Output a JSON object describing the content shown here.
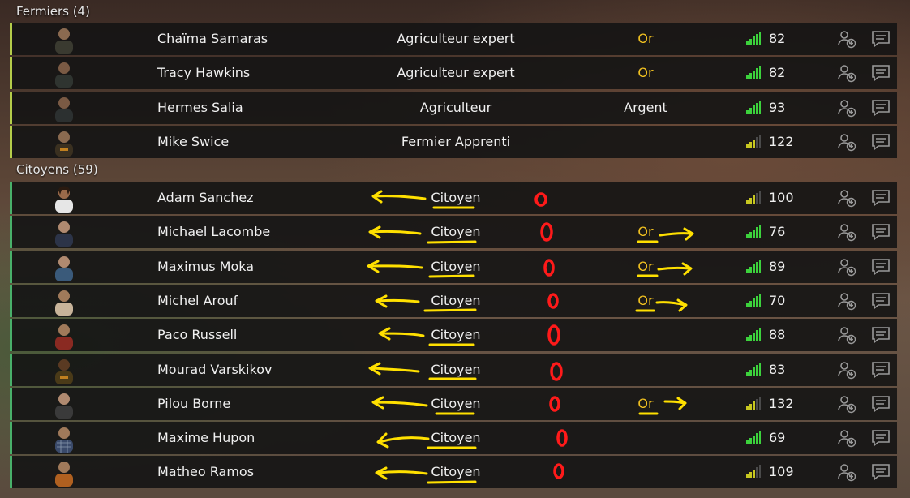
{
  "groups": [
    {
      "title": "Fermiers (4)",
      "players": [
        {
          "name": "Chaïma Samaras",
          "role": "Agriculteur expert",
          "rank": "Or",
          "ping": "82",
          "signal": "full",
          "avatar": "#3a3a30"
        },
        {
          "name": "Tracy Hawkins",
          "role": "Agriculteur expert",
          "rank": "Or",
          "ping": "82",
          "signal": "full",
          "avatar": "#2f3430"
        },
        {
          "name": "Hermes Salia",
          "role": "Agriculteur",
          "rank": "Argent",
          "ping": "93",
          "signal": "full",
          "avatar": "#2c3030"
        },
        {
          "name": "Mike Swice",
          "role": "Fermier Apprenti",
          "rank": "",
          "ping": "122",
          "signal": "partial",
          "avatar": "#3a3020"
        }
      ]
    },
    {
      "title": "Citoyens (59)",
      "players": [
        {
          "name": "Adam Sanchez",
          "role": "Citoyen",
          "rank": "",
          "ping": "100",
          "signal": "partial",
          "avatar": "#e6e6e6"
        },
        {
          "name": "Michael Lacombe",
          "role": "Citoyen",
          "rank": "Or",
          "ping": "76",
          "signal": "full",
          "avatar": "#2c3448"
        },
        {
          "name": "Maximus Moka",
          "role": "Citoyen",
          "rank": "Or",
          "ping": "89",
          "signal": "full",
          "avatar": "#3a5a7a"
        },
        {
          "name": "Michel Arouf",
          "role": "Citoyen",
          "rank": "Or",
          "ping": "70",
          "signal": "full",
          "avatar": "#c8b49a"
        },
        {
          "name": "Paco Russell",
          "role": "Citoyen",
          "rank": "",
          "ping": "88",
          "signal": "full",
          "avatar": "#8a2a22"
        },
        {
          "name": "Mourad Varskikov",
          "role": "Citoyen",
          "rank": "",
          "ping": "83",
          "signal": "full",
          "avatar": "#4a3a18"
        },
        {
          "name": "Pilou Borne",
          "role": "Citoyen",
          "rank": "Or",
          "ping": "132",
          "signal": "partial",
          "avatar": "#3a3a3a"
        },
        {
          "name": "Maxime Hupon",
          "role": "Citoyen",
          "rank": "",
          "ping": "69",
          "signal": "full",
          "avatar": "#3a4a6a"
        },
        {
          "name": "Matheo Ramos",
          "role": "Citoyen",
          "rank": "",
          "ping": "109",
          "signal": "partial",
          "avatar": "#b06020"
        }
      ]
    }
  ],
  "colors": {
    "fermier_stripe": "#b4cc4a",
    "citoyen_stripe": "#49b06a",
    "gold": "#f0c020",
    "signal_green": "#3cd23c",
    "signal_yellow": "#c8c820",
    "annotation_yellow": "#ffe000",
    "annotation_red": "#ff1a1a"
  },
  "icons": [
    "person-avatar",
    "signal-bars-icon",
    "add-friend-icon",
    "chat-icon"
  ]
}
